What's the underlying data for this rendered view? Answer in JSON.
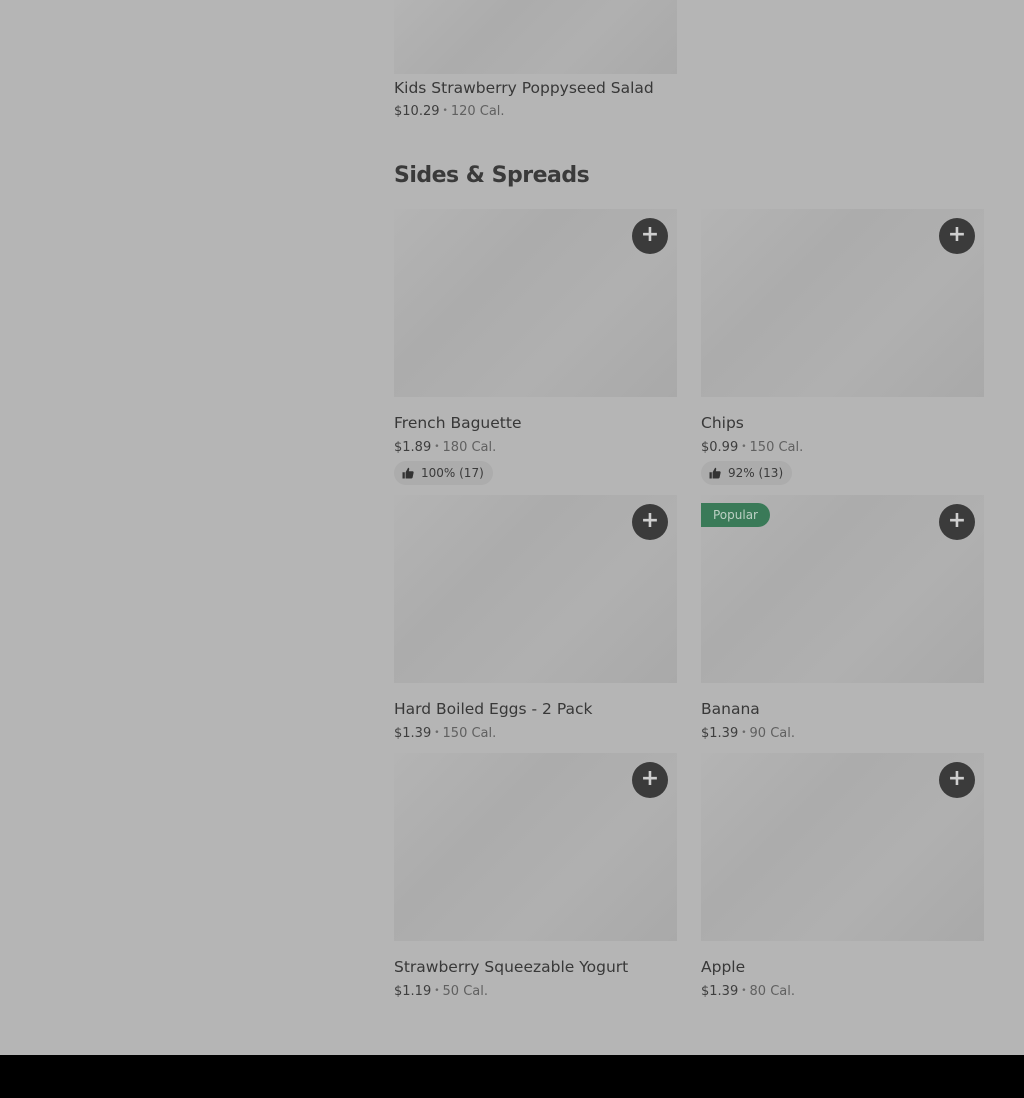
{
  "top_item": {
    "name": "Kids Strawberry Poppyseed Salad",
    "price": "$10.29",
    "separator": "•",
    "calories": "120 Cal."
  },
  "section": {
    "title": "Sides & Spreads"
  },
  "add_icon": "plus-icon",
  "rating_icon": "thumbs-up-icon",
  "items": [
    {
      "name": "French Baguette",
      "price": "$1.89",
      "separator": "•",
      "calories": "180 Cal.",
      "rating": "100% (17)",
      "add_label": "+"
    },
    {
      "name": "Chips",
      "price": "$0.99",
      "separator": "•",
      "calories": "150 Cal.",
      "rating": "92% (13)",
      "add_label": "+"
    },
    {
      "name": "Hard Boiled Eggs - 2 Pack",
      "price": "$1.39",
      "separator": "•",
      "calories": "150 Cal.",
      "add_label": "+"
    },
    {
      "name": "Banana",
      "price": "$1.39",
      "separator": "•",
      "calories": "90 Cal.",
      "badge": "Popular",
      "add_label": "+"
    },
    {
      "name": "Strawberry Squeezable Yogurt",
      "price": "$1.19",
      "separator": "•",
      "calories": "50 Cal.",
      "add_label": "+"
    },
    {
      "name": "Apple",
      "price": "$1.39",
      "separator": "•",
      "calories": "80 Cal.",
      "add_label": "+"
    }
  ],
  "colors": {
    "overlay_background": "#b5b5b5",
    "button": "#3b3b3b",
    "popular_badge": "#3a7a58",
    "footer": "#000000"
  }
}
